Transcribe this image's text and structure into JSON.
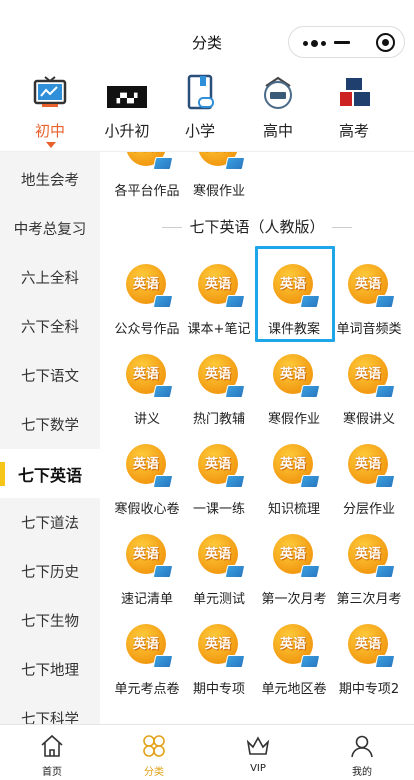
{
  "titlebar": {
    "title": "分类"
  },
  "levels": [
    {
      "label": "初中",
      "icon": "chalkboard-icon",
      "active": true
    },
    {
      "label": "小升初",
      "icon": "xiaoshengchu-banner-icon",
      "active": false
    },
    {
      "label": "小学",
      "icon": "book-link-icon",
      "active": false
    },
    {
      "label": "高中",
      "icon": "gaozhong-circle-icon",
      "active": false
    },
    {
      "label": "高考",
      "icon": "gaokao-icon",
      "active": false
    }
  ],
  "sidebar": {
    "items": [
      {
        "label": "地生会考"
      },
      {
        "label": "中考总复习"
      },
      {
        "label": "六上全科"
      },
      {
        "label": "六下全科"
      },
      {
        "label": "七下语文"
      },
      {
        "label": "七下数学"
      },
      {
        "label": "七下英语",
        "active": true
      },
      {
        "label": "七下道法"
      },
      {
        "label": "七下历史"
      },
      {
        "label": "七下生物"
      },
      {
        "label": "七下地理"
      },
      {
        "label": "七下科学"
      }
    ]
  },
  "main": {
    "top_partial": [
      "各平台作品",
      "寒假作业"
    ],
    "section_title": "七下英语（人教版）",
    "badge_text": "英语",
    "items": [
      "公众号作品",
      "课本+笔记",
      "课件教案",
      "单词音频类",
      "讲义",
      "热门教辅",
      "寒假作业",
      "寒假讲义",
      "寒假收心卷",
      "一课一练",
      "知识梳理",
      "分层作业",
      "速记清单",
      "单元测试",
      "第一次月考",
      "第三次月考",
      "单元考点卷",
      "期中专项",
      "单元地区卷",
      "期中专项2"
    ],
    "highlighted_item": "课件教案"
  },
  "bottomnav": [
    {
      "label": "首页",
      "icon": "home-icon",
      "active": false
    },
    {
      "label": "分类",
      "icon": "category-icon",
      "active": true
    },
    {
      "label": "VIP",
      "icon": "crown-icon",
      "active": false
    },
    {
      "label": "我的",
      "icon": "user-icon",
      "active": false
    }
  ],
  "colors": {
    "accent": "#e8612c",
    "sidebar_active_bar": "#f5c518",
    "highlight_border": "#1ea6e8",
    "nav_active": "#e2a21a"
  }
}
